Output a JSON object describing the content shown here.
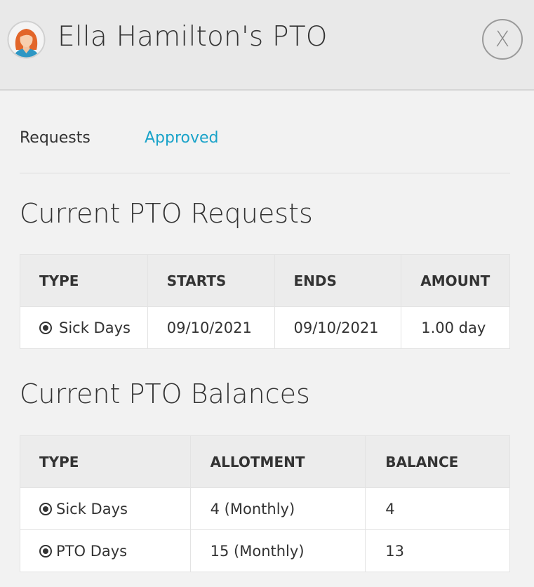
{
  "header": {
    "title": "Ella Hamilton's PTO",
    "close_label": "X",
    "avatar_icon": "user-avatar-icon"
  },
  "tabs": [
    {
      "label": "Requests",
      "active": false
    },
    {
      "label": "Approved",
      "active": true
    }
  ],
  "requests": {
    "title": "Current PTO Requests",
    "columns": [
      "TYPE",
      "STARTS",
      "ENDS",
      "AMOUNT"
    ],
    "rows": [
      {
        "type": "Sick Days",
        "starts": "09/10/2021",
        "ends": "09/10/2021",
        "amount": "1.00 day"
      }
    ]
  },
  "balances": {
    "title": "Current PTO Balances",
    "columns": [
      "TYPE",
      "ALLOTMENT",
      "BALANCE"
    ],
    "rows": [
      {
        "type": "Sick Days",
        "allotment": "4 (Monthly)",
        "balance": "4"
      },
      {
        "type": "PTO Days",
        "allotment": "15 (Monthly)",
        "balance": "13"
      }
    ]
  },
  "colors": {
    "accent": "#1aa3c9",
    "header_bg": "#e9e9e9",
    "page_bg": "#f2f2f2"
  }
}
